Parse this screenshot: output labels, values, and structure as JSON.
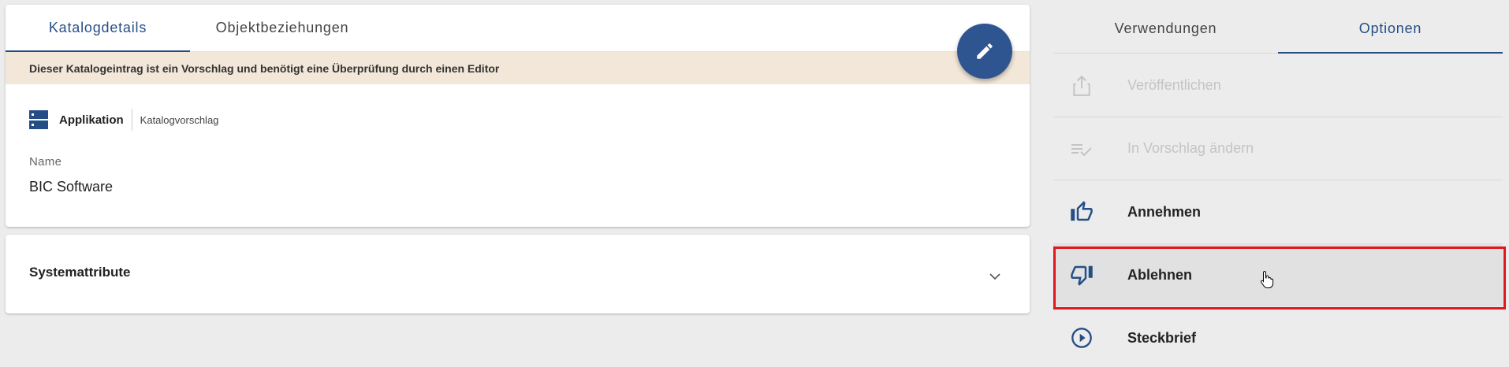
{
  "details": {
    "tabs": [
      {
        "label": "Katalogdetails",
        "active": true
      },
      {
        "label": "Objektbeziehungen",
        "active": false
      }
    ],
    "banner": "Dieser Katalogeintrag ist ein Vorschlag und benötigt eine Überprüfung durch einen Editor",
    "edit_icon": "pencil-icon",
    "type": {
      "icon": "application-icon",
      "label": "Applikation",
      "status": "Katalogvorschlag"
    },
    "name_label": "Name",
    "name_value": "BIC Software"
  },
  "system": {
    "title": "Systemattribute",
    "toggle_icon": "chevron-down-icon"
  },
  "panel": {
    "tabs": [
      {
        "label": "Verwendungen",
        "active": false
      },
      {
        "label": "Optionen",
        "active": true
      }
    ],
    "options": [
      {
        "label": "Veröffentlichen",
        "icon": "share-icon",
        "disabled": true
      },
      {
        "label": "In Vorschlag ändern",
        "icon": "playlist-check-icon",
        "disabled": true
      },
      {
        "label": "Annehmen",
        "icon": "thumb-up-icon",
        "disabled": false
      },
      {
        "label": "Ablehnen",
        "icon": "thumb-down-icon",
        "disabled": false,
        "hovered": true
      },
      {
        "label": "Steckbrief",
        "icon": "play-circle-icon",
        "disabled": false
      }
    ]
  },
  "colors": {
    "primary": "#264e86",
    "fab": "#2f5591",
    "banner_bg": "#f2e7d8",
    "highlight": "#e0171d",
    "background": "#ececec"
  }
}
